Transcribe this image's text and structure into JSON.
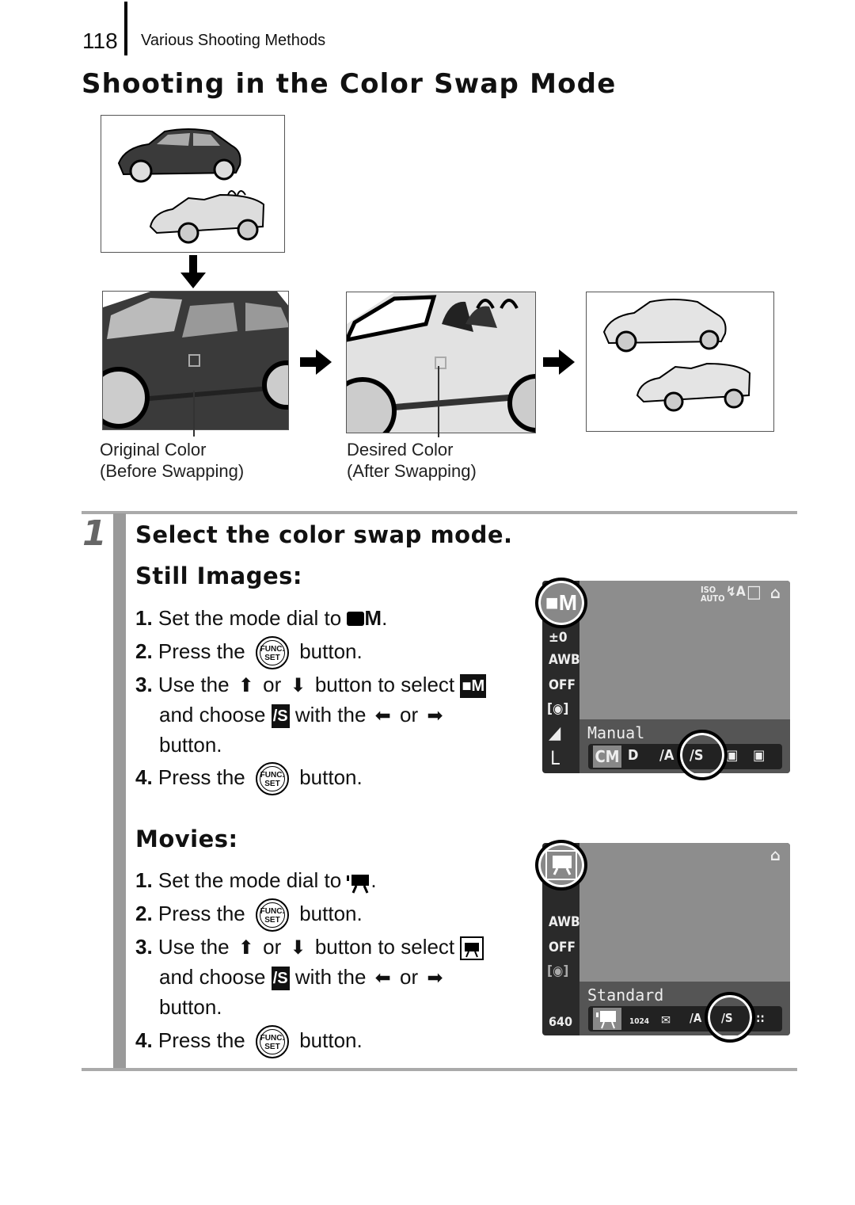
{
  "header": {
    "page_number": "118",
    "section": "Various Shooting Methods"
  },
  "title": "Shooting in the Color Swap Mode",
  "illustration": {
    "original_caption": [
      "Original Color",
      "(Before Swapping)"
    ],
    "desired_caption": [
      "Desired Color",
      "(After Swapping)"
    ]
  },
  "step": {
    "number": "1",
    "heading": "Select the color swap mode.",
    "still": {
      "heading": "Still Images:",
      "mode_icon": "■M",
      "items": [
        {
          "n": "1.",
          "pre": "Set the mode dial to",
          "post": "."
        },
        {
          "n": "2.",
          "pre": "Press the",
          "post": "button."
        },
        {
          "n": "3.",
          "pre": "Use the",
          "or": "or",
          "mid": "button to select",
          "line2a": "and choose",
          "line2b": "with the",
          "line2c": "or",
          "line3": "button."
        },
        {
          "n": "4.",
          "pre": "Press the",
          "post": "button."
        }
      ],
      "lcd": {
        "mode_label": "Manual",
        "left_icons": [
          "±0",
          "AWB",
          "OFF",
          "[◉]",
          "◢",
          "L"
        ],
        "top_icons": [
          "ISO AUTO",
          "↯A",
          "□",
          "⌂"
        ],
        "options": [
          "CM",
          "D",
          "/A",
          "/S",
          "▣",
          "▣"
        ]
      }
    },
    "movies": {
      "heading": "Movies:",
      "items": [
        {
          "n": "1.",
          "pre": "Set the mode dial to",
          "post": "."
        },
        {
          "n": "2.",
          "pre": "Press the",
          "post": "button."
        },
        {
          "n": "3.",
          "pre": "Use the",
          "or": "or",
          "mid": "button to select",
          "line2a": "and choose",
          "line2b": "with the",
          "line2c": "or",
          "line3": "button."
        },
        {
          "n": "4.",
          "pre": "Press the",
          "post": "button."
        }
      ],
      "lcd": {
        "mode_label": "Standard",
        "left_icons": [
          "AWB",
          "OFF",
          "[◉]",
          "640"
        ],
        "top_icons": [
          "⌂"
        ],
        "options": [
          "",
          "1024",
          "✉",
          "/A",
          "/S",
          "::"
        ]
      }
    }
  },
  "func_button": {
    "top": "FUNC.",
    "bottom": "SET"
  },
  "arrows": {
    "up": "⬆",
    "down": "⬇",
    "left": "⬅",
    "right": "➡"
  }
}
